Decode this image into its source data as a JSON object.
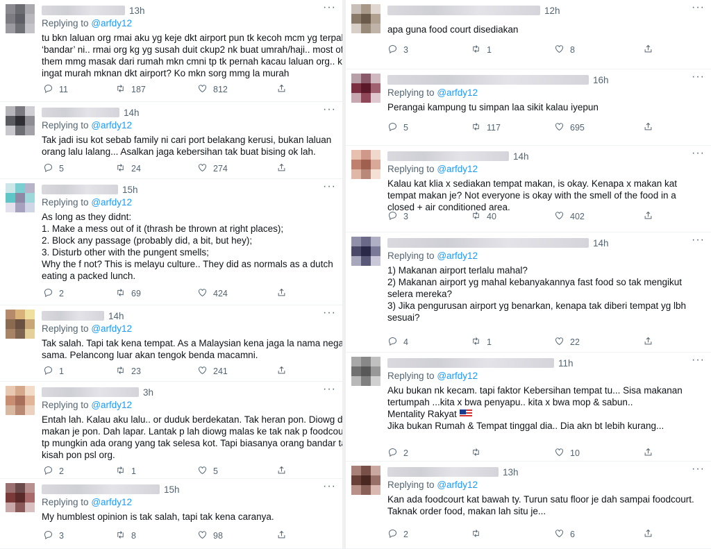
{
  "reply_prefix": "Replying to",
  "handle": "@arfdy12",
  "more_glyph": "···",
  "left": [
    {
      "time": "13h",
      "replying": true,
      "lines": [
        "tu bkn laluan org rmai aku yg keje dkt airport pun tk kecoh mcm yg terpaling",
        "‘bandar’ ni.. rmai org kg yg susah duit ckup2 nk buat umrah/haji.. most of",
        "them mmg masak dari rumah mkn cmni tp tk pernah kacau laluan org.. ko",
        "ingat murah mknan dkt airport? Ko mkn sorg mmg la murah"
      ],
      "replies": "11",
      "retweets": "187",
      "likes": "812",
      "avatar": [
        "#8a8a90",
        "#6b6b72",
        "#a9a9ae",
        "#7c7c82",
        "#5e5e66",
        "#b8b8bc",
        "#9a9aa0",
        "#6f6f76",
        "#c4c4c8"
      ]
    },
    {
      "time": "14h",
      "replying": true,
      "lines": [
        "Tak jadi isu kot sebab family ni cari port belakang kerusi, bukan laluan",
        "orang lalu lalang... Asalkan jaga kebersihan tak buat bising ok lah."
      ],
      "replies": "5",
      "retweets": "24",
      "likes": "274",
      "avatar": [
        "#b5b5ba",
        "#7a7a80",
        "#cfcfd3",
        "#5b5b62",
        "#2e2e33",
        "#8d8d93",
        "#c8c8cc",
        "#6d6d74",
        "#a2a2a8"
      ]
    },
    {
      "time": "15h",
      "replying": true,
      "lines": [
        "As long as they didnt:",
        "1. Make a mess out of it (thrash be thrown at right places);",
        "2. Block any passage (probably did, a bit, but hey);",
        "3. Disturb other with the pungent smells;",
        "Why the f not? This is melayu culture.. They did as normals as a dutch",
        "eating a packed lunch."
      ],
      "replies": "2",
      "retweets": "69",
      "likes": "424",
      "avatar": [
        "#cde6e8",
        "#7ccfd0",
        "#b7b3c9",
        "#5fc6c8",
        "#8e8aa6",
        "#9fd8da",
        "#e4e0ec",
        "#a6a2bd",
        "#d1d6e6"
      ]
    },
    {
      "time": "14h",
      "replying": true,
      "lines": [
        "Tak salah. Tapi tak kena tempat. As a Malaysian kena jaga la nama negara",
        "sama. Pelancong luar akan tengok benda macamni."
      ],
      "replies": "1",
      "retweets": "23",
      "likes": "241",
      "avatar": [
        "#b58a6a",
        "#d9b27a",
        "#f0e0a0",
        "#8a6a50",
        "#6a5040",
        "#c9a678",
        "#a88466",
        "#7d6450",
        "#e5d09a"
      ]
    },
    {
      "time": "3h",
      "replying": true,
      "lines": [
        "Entah lah. Kalau aku lalu.. or duduk berdekatan. Tak heran pon. Diowg duk",
        "makan je pon. Dah lapar. Lantak p lah diowg malas ke tak nak p foodcourt..",
        "tp mungkin ada orang yang tak selesa kot. Tapi biasanya orang bandar tak",
        "kisah pon psl org."
      ],
      "replies": "2",
      "retweets": "1",
      "likes": "5",
      "avatar": [
        "#e8c8b0",
        "#d4a88a",
        "#f2dcc8",
        "#c98e72",
        "#a8705a",
        "#e2b498",
        "#d8b8a0",
        "#b88a74",
        "#ecd2be"
      ]
    },
    {
      "time": "15h",
      "replying": true,
      "lines": [
        "My humblest opinion is tak salah, tapi tak kena caranya."
      ],
      "replies": "3",
      "retweets": "8",
      "likes": "98",
      "avatar": [
        "#9a7070",
        "#6a4a4a",
        "#b89090",
        "#7a3a3a",
        "#5a2a2a",
        "#a86a6a",
        "#c8a8a8",
        "#8a5a5a",
        "#d8c0c0"
      ]
    }
  ],
  "right": [
    {
      "time": "12h",
      "replying": false,
      "lines": [
        "apa guna food court disediakan"
      ],
      "replies": "3",
      "retweets": "1",
      "likes": "8",
      "avatar": [
        "#c8c0b8",
        "#a89888",
        "#e0d8d0",
        "#8a7a6a",
        "#6a5a4a",
        "#b0a090",
        "#d8d0c8",
        "#9a8a7a",
        "#c0b4a8"
      ]
    },
    {
      "time": "16h",
      "replying": true,
      "lines": [
        "Perangai kampung tu simpan laa sikit kalau iyepun"
      ],
      "replies": "5",
      "retweets": "117",
      "likes": "695",
      "avatar": [
        "#b8a0a8",
        "#8a5a6a",
        "#d0b8c0",
        "#7a3040",
        "#5a1828",
        "#a06070",
        "#c8a8b0",
        "#904858",
        "#e0c8d0"
      ]
    },
    {
      "time": "14h",
      "replying": true,
      "lines": [
        "Kalau kat klia x sediakan tempat makan, is okay. Kenapa x makan kat",
        "tempat makan je? Not everyone is okay with the smell of the food in a",
        "closed + air conditioned area."
      ],
      "replies": "3",
      "retweets": "40",
      "likes": "402",
      "avatar": [
        "#e8c0b0",
        "#d09888",
        "#f0d8cc",
        "#c08070",
        "#a06050",
        "#d8a898",
        "#e0b8a8",
        "#b88878",
        "#f4e0d4"
      ]
    },
    {
      "time": "14h",
      "replying": true,
      "lines": [
        "1) Makanan airport terlalu mahal?",
        "2) Makanan airport yg mahal  kebanyakannya fast food so tak mengikut",
        "selera mereka?",
        "3) Jika pengurusan airport yg benarkan, kenapa tak diberi tempat yg lbh",
        "sesuai?"
      ],
      "replies": "4",
      "retweets": "1",
      "likes": "22",
      "avatar": [
        "#9090a8",
        "#6a6a88",
        "#b0b0c4",
        "#4a4a68",
        "#2a2a48",
        "#7a7a98",
        "#a8a8bc",
        "#5a5a78",
        "#c8c8d8"
      ]
    },
    {
      "time": "11h",
      "replying": true,
      "lines": [
        "Aku bukan nk kecam. tapi faktor Kebersihan tempat tu... Sisa makanan",
        "tertumpah ...kita x bwa penyapu.. kita x bwa mop & sabun..",
        "Mentality Rakyat",
        "Jika bukan Rumah & Tempat tinggal dia.. Dia akn bt lebih kurang..."
      ],
      "flag_line": 2,
      "replies": "2",
      "retweets": "",
      "likes": "10",
      "avatar": [
        "#a8a8a8",
        "#888888",
        "#c0c0c0",
        "#707070",
        "#585858",
        "#989898",
        "#b8b8b8",
        "#808080",
        "#d0d0d0"
      ]
    },
    {
      "time": "13h",
      "replying": true,
      "lines": [
        "Kan ada foodcourt kat bawah ty. Turun satu floor je dah sampai foodcourt.",
        "Taknak order food, makan lah situ je..."
      ],
      "replies": "2",
      "retweets": "",
      "likes": "6",
      "avatar": [
        "#a88078",
        "#785048",
        "#c8a8a0",
        "#684038",
        "#482820",
        "#987068",
        "#b89088",
        "#886058",
        "#d8b8b0"
      ]
    }
  ]
}
